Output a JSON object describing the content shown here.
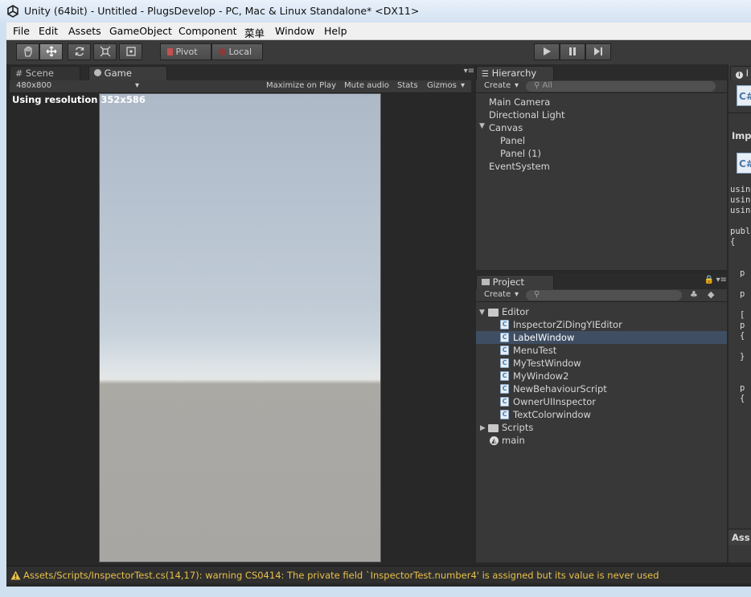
{
  "window": {
    "title": "Unity (64bit) - Untitled - PlugsDevelop - PC, Mac & Linux Standalone* <DX11>"
  },
  "menu": [
    "File",
    "Edit",
    "Assets",
    "GameObject",
    "Component",
    "菜单",
    "Window",
    "Help"
  ],
  "toolbar": {
    "pivot_label": "Pivot",
    "local_label": "Local"
  },
  "scene_tabs": {
    "scene_label": "Scene",
    "game_label": "Game"
  },
  "game_bar": {
    "resolution": "480x800",
    "maximize_on_play": "Maximize on Play",
    "mute_audio": "Mute audio",
    "stats": "Stats",
    "gizmos": "Gizmos"
  },
  "game_view": {
    "resolution_text": "Using resolution 352x586"
  },
  "hierarchy": {
    "tab_label": "Hierarchy",
    "create_label": "Create",
    "search_placeholder": "All",
    "items": [
      "Main Camera",
      "Directional Light",
      "Canvas",
      "Panel",
      "Panel (1)",
      "EventSystem"
    ]
  },
  "project": {
    "tab_label": "Project",
    "create_label": "Create",
    "folder_editor": "Editor",
    "scripts": [
      "InspectorZiDingYIEditor",
      "LabelWindow",
      "MenuTest",
      "MyTestWindow",
      "MyWindow2",
      "NewBehaviourScript",
      "OwnerUIInspector",
      "TextColorwindow"
    ],
    "folder_scripts": "Scripts",
    "scene_main": "main"
  },
  "inspector": {
    "tab_label": "I",
    "imp_label": "Imp",
    "code_lines": [
      "usin",
      "usin",
      "usin",
      "",
      "publ",
      "{",
      "",
      "",
      "p",
      "",
      "p",
      "",
      "[",
      "p",
      "{",
      "",
      "}",
      "",
      "",
      "p",
      "{"
    ],
    "assets_label": "Ass"
  },
  "status": {
    "warning": "Assets/Scripts/InspectorTest.cs(14,17): warning CS0414: The private field `InspectorTest.number4' is assigned but its value is never used"
  },
  "colors": {
    "editor_bg": "#282828",
    "panel_bg": "#3c3c3c",
    "selection": "#3f4e63",
    "warning": "#e8c04a",
    "sky_top": "#b0bccb",
    "ground": "#a7a6a3"
  }
}
